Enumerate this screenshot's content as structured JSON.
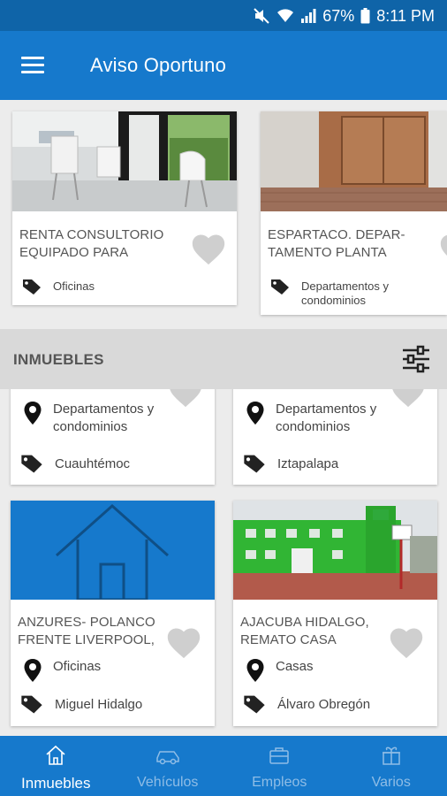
{
  "status_bar": {
    "battery": "67%",
    "time": "8:11 PM"
  },
  "app_bar": {
    "title": "Aviso Oportuno"
  },
  "featured": [
    {
      "title": "RENTA CONSULTORIO EQUIPADO PARA",
      "category": "Oficinas"
    },
    {
      "title": "ESPARTACO. DEPAR-TAMENTO PLANTA",
      "category": "Departamentos y condominios"
    }
  ],
  "section": {
    "title": "INMUEBLES"
  },
  "listings_partial": [
    {
      "type": "Departamentos y condominios",
      "location": "Cuauhtémoc"
    },
    {
      "type": "Departamentos y condominios",
      "location": "Iztapalapa"
    }
  ],
  "listings": [
    {
      "title": "ANZURES- POLANCO FRENTE LIVERPOOL,",
      "type": "Oficinas",
      "location": "Miguel Hidalgo",
      "placeholder_color": "#1679cc"
    },
    {
      "title": "AJACUBA HIDALGO, REMATO CASA",
      "type": "Casas",
      "location": "Álvaro Obregón"
    }
  ],
  "bottom_nav": [
    {
      "label": "Inmuebles",
      "icon": "home-icon",
      "active": true
    },
    {
      "label": "Vehículos",
      "icon": "car-icon",
      "active": false
    },
    {
      "label": "Empleos",
      "icon": "briefcase-icon",
      "active": false
    },
    {
      "label": "Varios",
      "icon": "gift-icon",
      "active": false
    }
  ],
  "colors": {
    "primary": "#1679cc",
    "status_bar": "#0f64a8",
    "heart": "#cfcfcf"
  }
}
